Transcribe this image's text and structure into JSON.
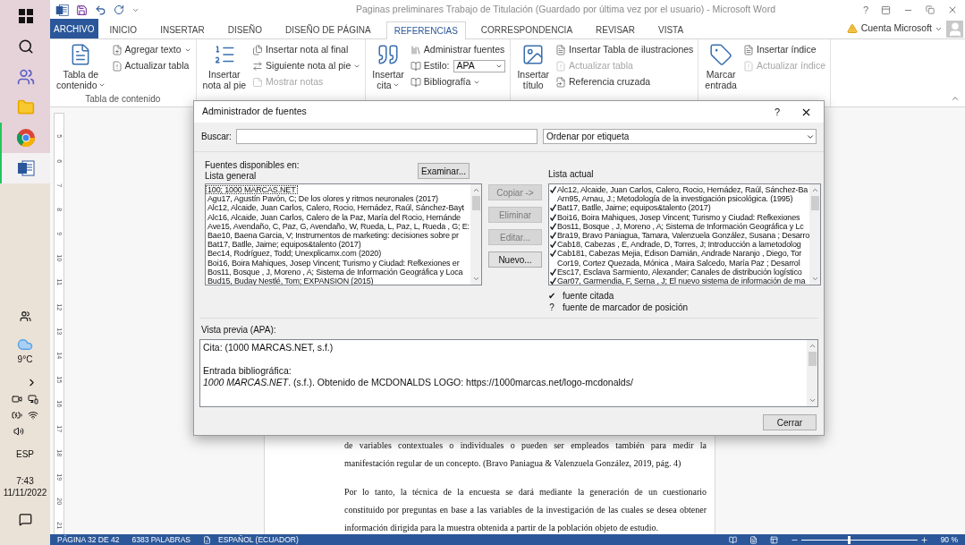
{
  "taskbar": {
    "pinned": [
      {
        "kind": "start",
        "selected": false,
        "running": false
      },
      {
        "kind": "search",
        "selected": false,
        "running": false
      },
      {
        "kind": "teams",
        "selected": false,
        "running": false
      },
      {
        "kind": "explorer",
        "selected": false,
        "running": false
      },
      {
        "kind": "chrome",
        "selected": false,
        "running": true
      },
      {
        "kind": "word",
        "selected": true,
        "running": true
      }
    ],
    "temperature": "9°C",
    "language": "ESP",
    "time": "7:43",
    "date": "11/11/2022"
  },
  "window": {
    "title": "Paginas preliminares Trabajo de Titulación (Guardado por última vez por el usuario) - Microsoft Word",
    "help": "?"
  },
  "tabs": [
    {
      "label": "ARCHIVO",
      "kind": "file",
      "selected": false
    },
    {
      "label": "INICIO",
      "kind": "tab",
      "selected": false
    },
    {
      "label": "INSERTAR",
      "kind": "tab",
      "selected": false
    },
    {
      "label": "DISEÑO",
      "kind": "tab",
      "selected": false
    },
    {
      "label": "DISEÑO DE PÁGINA",
      "kind": "tab",
      "selected": false
    },
    {
      "label": "REFERENCIAS",
      "kind": "tab",
      "selected": true
    },
    {
      "label": "CORRESPONDENCIA",
      "kind": "tab",
      "selected": false
    },
    {
      "label": "REVISAR",
      "kind": "tab",
      "selected": false
    },
    {
      "label": "VISTA",
      "kind": "tab",
      "selected": false
    }
  ],
  "account": {
    "label": "Cuenta Microsoft",
    "warning": true
  },
  "ribbon": {
    "groups": [
      {
        "label": "Tabla de contenido",
        "large": {
          "lines": [
            "Tabla de",
            "contenido"
          ],
          "dropdown": true
        },
        "small": [
          {
            "label": "Agregar texto",
            "dropdown": true,
            "disabled": false
          },
          {
            "label": "Actualizar tabla",
            "dropdown": false,
            "disabled": false
          }
        ]
      },
      {
        "large": {
          "lines": [
            "Insertar",
            "nota al pie"
          ],
          "dropdown": false
        },
        "small": [
          {
            "label": "Insertar nota al final",
            "dropdown": false,
            "disabled": false
          },
          {
            "label": "Siguiente nota al pie",
            "dropdown": true,
            "disabled": false
          },
          {
            "label": "Mostrar notas",
            "dropdown": false,
            "disabled": true
          }
        ]
      },
      {
        "large": {
          "lines": [
            "Insertar",
            "cita"
          ],
          "dropdown": true
        },
        "small": [
          {
            "label": "Administrar fuentes",
            "dropdown": false,
            "disabled": false
          },
          {
            "label": "Estilo:",
            "dropdown": false,
            "disabled": false,
            "select": "APA"
          },
          {
            "label": "Bibliografía",
            "dropdown": true,
            "disabled": false
          }
        ]
      },
      {
        "large": {
          "lines": [
            "Insertar",
            "título"
          ],
          "dropdown": false
        },
        "small": [
          {
            "label": "Insertar Tabla de ilustraciones",
            "dropdown": false,
            "disabled": false
          },
          {
            "label": "Actualizar tabla",
            "dropdown": false,
            "disabled": true
          },
          {
            "label": "Referencia cruzada",
            "dropdown": false,
            "disabled": false
          }
        ]
      },
      {
        "large": {
          "lines": [
            "Marcar",
            "entrada"
          ],
          "dropdown": false
        },
        "small": [
          {
            "label": "Insertar índice",
            "dropdown": false,
            "disabled": false
          },
          {
            "label": "Actualizar índice",
            "dropdown": false,
            "disabled": true
          }
        ]
      }
    ]
  },
  "ruler": [
    "5",
    "6",
    "7",
    "8",
    "9",
    "10",
    "11",
    "12",
    "13",
    "14",
    "15",
    "16",
    "17",
    "18",
    "19",
    "20",
    "21"
  ],
  "document": {
    "paragraphs": [
      {
        "lines": [
          "de variables contextuales o individuales o pueden ser empleados también para medir la",
          "manifestación regular de un concepto. (Bravo Paniagua & Valenzuela González, 2019, pág. 4)"
        ]
      },
      {
        "lines": [
          "Por lo tanto, la técnica de la encuesta se dará mediante la generación de un cuestionario",
          "constituido por preguntas en base a las variables de la investigación de las cuales se desea obtener",
          "información dirigida para la muestra obtenida a partir de la población objeto de estudio."
        ]
      }
    ]
  },
  "dialog": {
    "title": "Administrador de fuentes",
    "help": "?",
    "search_label": "Buscar:",
    "sort": "Ordenar por etiqueta",
    "sources_label": "Fuentes disponibles en:",
    "general_label": "Lista general",
    "browse": "Examinar...",
    "current_label": "Lista actual",
    "general_list": [
      {
        "text": "100; 1000 MARCAS.NET",
        "selected": true
      },
      {
        "text": "Agu17, Agustín Pavón, C; De los olores y ritmos neuronales (2017)",
        "selected": false
      },
      {
        "text": "Alc12, Alcaide, Juan Carlos, Calero, Rocio, Hernádez, Raúl, Sánchez-Bayt",
        "selected": false
      },
      {
        "text": "Alc16, Alcaide, Juan Carlos, Calero de la Paz, María  del Rocio, Hernánde",
        "selected": false
      },
      {
        "text": "Ave15, Avendaño, C, Paz, G, Avendaño, W, Rueda, L, Paz, L, Rueda , G; E:",
        "selected": false
      },
      {
        "text": "Bae10, Baena Garcia, V; Instrumentos de marketing: decisiones sobre pr",
        "selected": false
      },
      {
        "text": "Bat17, Batlle, Jaime; equipos&talento (2017)",
        "selected": false
      },
      {
        "text": "Bec14, Rodríguez, Todd; Unexplicamx.com (2020)",
        "selected": false
      },
      {
        "text": "Boi16, Boira Mahiques, Josep Vincent; Turismo y Ciudad: Refkexiones er",
        "selected": false
      },
      {
        "text": "Bos11, Bosque , J, Moreno , A; Sistema de Información Geográfica y Loca",
        "selected": false
      },
      {
        "text": "Bud15,  Buday Nestlé, Tom; EXPANSION (2015)",
        "selected": false
      }
    ],
    "buttons": [
      {
        "label": "Copiar ->",
        "disabled": true
      },
      {
        "label": "Eliminar",
        "disabled": true
      },
      {
        "label": "Editar...",
        "disabled": true
      },
      {
        "label": "Nuevo...",
        "disabled": false
      }
    ],
    "current_list": [
      {
        "text": "Alc12, Alcaide, Juan Carlos, Calero, Rocio, Hernádez, Raúl, Sánchez-Ba",
        "cited": true
      },
      {
        "text": "Arn95, Arnau, J.;  Metodología de la investigación psicológica. (1995)",
        "cited": false
      },
      {
        "text": "Bat17, Batlle, Jaime; equipos&talento (2017)",
        "cited": true
      },
      {
        "text": "Boi16, Boira Mahiques, Josep Vincent; Turismo y Ciudad: Refkexiones",
        "cited": true
      },
      {
        "text": "Bos11, Bosque , J, Moreno , A; Sistema de Información Geográfica y Lc",
        "cited": true
      },
      {
        "text": "Bra19, Bravo Paniagua, Tamara, Valenzuela González, Susana ; Desarro",
        "cited": true
      },
      {
        "text": "Cab18, Cabezas , E, Andrade, D, Torres, J; Introducción a lametodolog",
        "cited": true
      },
      {
        "text": "Cab181, Cabezas Mejia, Edison Damián, Andrade Naranjo , Diego, Tor",
        "cited": true
      },
      {
        "text": "Cor19,  Cortez Quezada, Mónica , Maira Salcedo, María  Paz ; Desarrol",
        "cited": false
      },
      {
        "text": "Esc17, Esclava Sarmiento, Alexander; Canales de distribución logístico",
        "cited": true
      },
      {
        "text": "Gar07, Garmendia, F, Serna , J; El nuevo sistema de información de ma",
        "cited": true
      }
    ],
    "legend": [
      {
        "symbol": "✔",
        "label": "fuente citada"
      },
      {
        "symbol": "?",
        "label": "fuente de marcador de posición"
      }
    ],
    "preview_label": "Vista previa (APA):",
    "preview": {
      "citation": "Cita:  (1000 MARCAS.NET, s.f.)",
      "entry_label": "Entrada bibliográfica:",
      "entry": "*1000 MARCAS.NET*. (s.f.). Obtenido de MCDONALDS LOGO: https://1000marcas.net/logo-mcdonalds/"
    },
    "close": "Cerrar"
  },
  "status_bar": {
    "page": "PÁGINA 32 DE 42",
    "words": "6383 PALABRAS",
    "language": "ESPAÑOL (ECUADOR)",
    "zoom": {
      "level": 0.4,
      "label": "90 %"
    }
  }
}
